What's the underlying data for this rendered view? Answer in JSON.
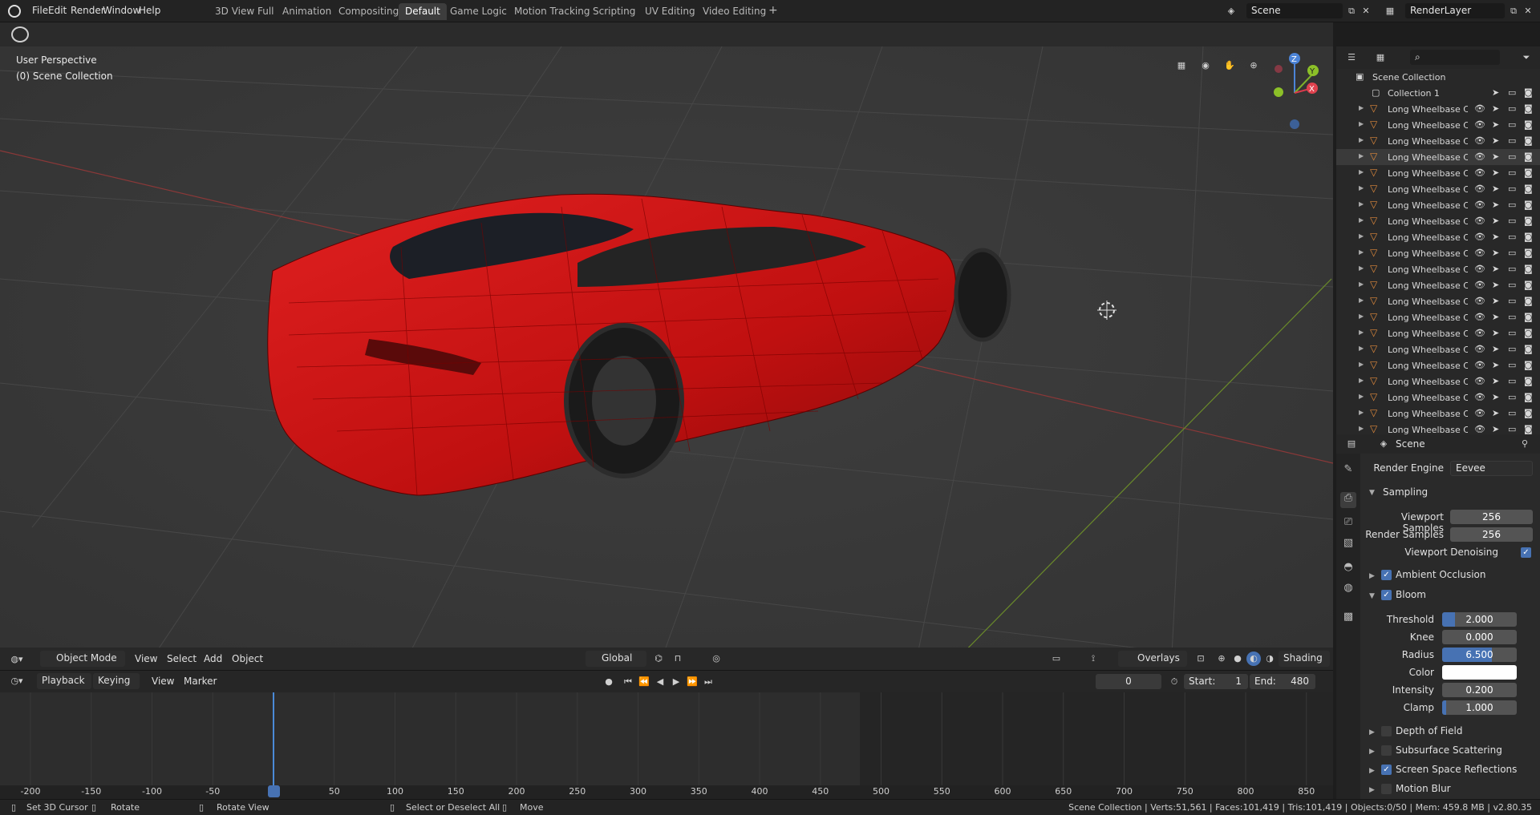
{
  "menu": [
    "File",
    "Edit",
    "Render",
    "Window",
    "Help"
  ],
  "workspaces": [
    "3D View Full",
    "Animation",
    "Compositing",
    "Default",
    "Game Logic",
    "Motion Tracking",
    "Scripting",
    "UV Editing",
    "Video Editing"
  ],
  "workspace_add": "+",
  "scene_name": "Scene",
  "render_layer": "RenderLayer",
  "viewport": {
    "perspective": "User Perspective",
    "collection": "(0) Scene Collection"
  },
  "axes": {
    "x": "X",
    "y": "Y",
    "z": "Z"
  },
  "header3d": {
    "mode": "Object Mode",
    "view": "View",
    "select": "Select",
    "add": "Add",
    "object": "Object",
    "orientation": "Global",
    "overlays": "Overlays",
    "shading": "Shading"
  },
  "timeline": {
    "playback": "Playback",
    "keying": "Keying",
    "view": "View",
    "marker": "Marker",
    "current_frame": "0",
    "start_label": "Start:",
    "start": "1",
    "end_label": "End:",
    "end": "480",
    "ticks": [
      "-200",
      "-150",
      "-100",
      "-50",
      "0",
      "50",
      "100",
      "150",
      "200",
      "250",
      "300",
      "350",
      "400",
      "450",
      "500",
      "550",
      "600",
      "650",
      "700",
      "750",
      "800",
      "850"
    ]
  },
  "status": {
    "cursor": "Set 3D Cursor",
    "rotate": "Rotate",
    "rotate_view": "Rotate View",
    "select": "Select or Deselect All",
    "move": "Move",
    "info": "Scene Collection | Verts:51,561 | Faces:101,419 | Tris:101,419 | Objects:0/50 | Mem: 459.8 MB | v2.80.35"
  },
  "outliner": {
    "root": "Scene Collection",
    "collection": "Collection 1",
    "items": [
      "Long Wheelbase Car",
      "Long Wheelbase Car",
      "Long Wheelbase Car",
      "Long Wheelbase Car",
      "Long Wheelbase Car",
      "Long Wheelbase Car",
      "Long Wheelbase Car",
      "Long Wheelbase Car",
      "Long Wheelbase Car",
      "Long Wheelbase Car",
      "Long Wheelbase Car",
      "Long Wheelbase Car",
      "Long Wheelbase Car",
      "Long Wheelbase Car",
      "Long Wheelbase Car",
      "Long Wheelbase Car",
      "Long Wheelbase Car",
      "Long Wheelbase Car",
      "Long Wheelbase Car",
      "Long Wheelbase Car",
      "Long Wheelbase Car"
    ]
  },
  "properties": {
    "context": "Scene",
    "render_engine_label": "Render Engine",
    "render_engine": "Eevee",
    "sampling": "Sampling",
    "viewport_samples_label": "Viewport Samples",
    "viewport_samples": "256",
    "render_samples_label": "Render Samples",
    "render_samples": "256",
    "viewport_denoising": "Viewport Denoising",
    "ambient_occlusion": "Ambient Occlusion",
    "bloom": "Bloom",
    "threshold_label": "Threshold",
    "threshold": "2.000",
    "knee_label": "Knee",
    "knee": "0.000",
    "radius_label": "Radius",
    "radius": "6.500",
    "color_label": "Color",
    "intensity_label": "Intensity",
    "intensity": "0.200",
    "clamp_label": "Clamp",
    "clamp": "1.000",
    "depth_of_field": "Depth of Field",
    "subsurface": "Subsurface Scattering",
    "ssr": "Screen Space Reflections",
    "motion_blur": "Motion Blur"
  }
}
